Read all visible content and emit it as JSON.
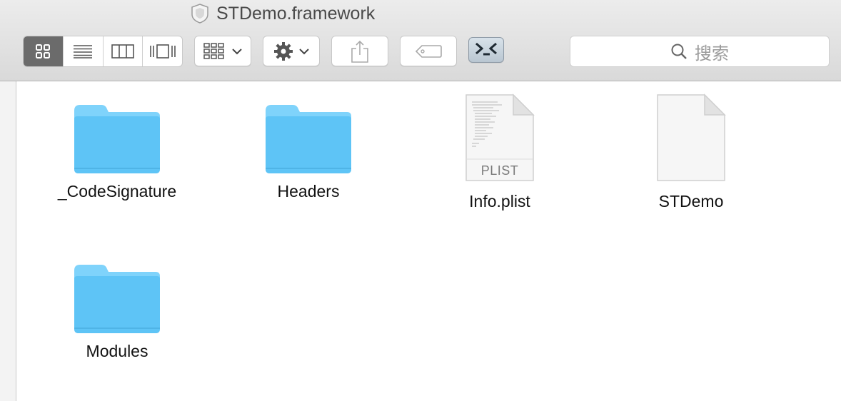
{
  "window": {
    "title": "STDemo.framework"
  },
  "toolbar": {
    "view_modes": [
      "icon-view",
      "list-view",
      "column-view",
      "cover-flow-view"
    ],
    "active_view": "icon-view",
    "search_placeholder": "搜索"
  },
  "files": [
    {
      "name": "_CodeSignature",
      "kind": "folder"
    },
    {
      "name": "Headers",
      "kind": "folder"
    },
    {
      "name": "Info.plist",
      "kind": "plist",
      "badge": "PLIST"
    },
    {
      "name": "STDemo",
      "kind": "document"
    },
    {
      "name": "Modules",
      "kind": "folder"
    }
  ],
  "colors": {
    "folder": "#5ec4f6",
    "folder_tab": "#7fd3fb",
    "active_segment": "#6b6b6b"
  }
}
